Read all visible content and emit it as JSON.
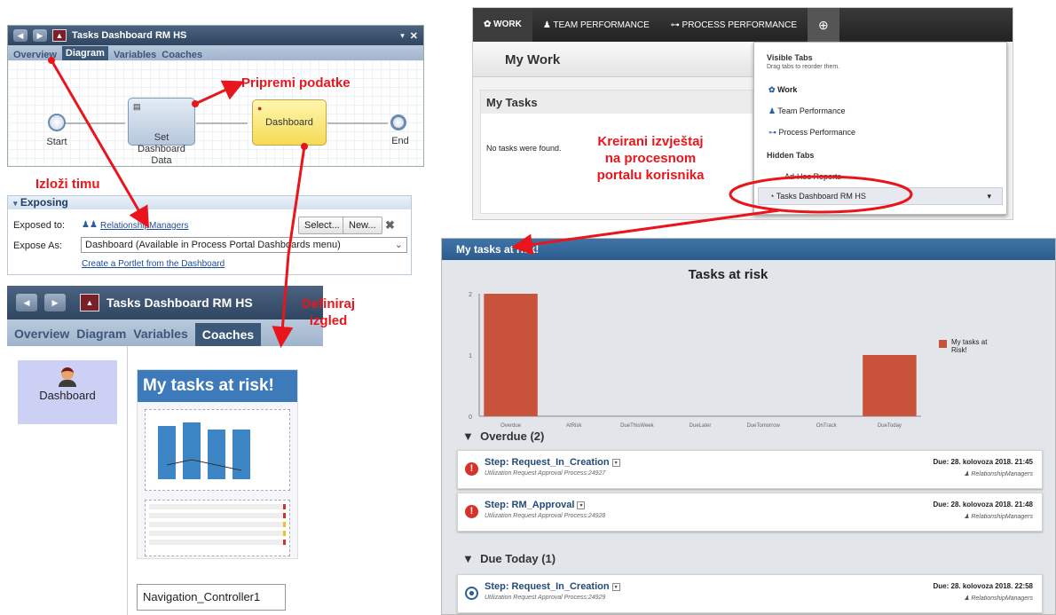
{
  "designer_top": {
    "title": "Tasks Dashboard RM HS",
    "tabs": [
      "Overview",
      "Diagram",
      "Variables",
      "Coaches"
    ],
    "active_tab": "Diagram",
    "nodes": {
      "start": "Start",
      "set_data": "Set\nDashboard\nData",
      "dashboard": "Dashboard",
      "end": "End"
    }
  },
  "exposing": {
    "header": "Exposing",
    "exposed_to_label": "Exposed to:",
    "exposed_to_value": "RelationshipManagers",
    "select_btn": "Select...",
    "new_btn": "New...",
    "expose_as_label": "Expose As:",
    "expose_as_value": "Dashboard (Available in Process Portal Dashboards menu)",
    "portlet_link": "Create a Portlet from the Dashboard"
  },
  "designer_bottom": {
    "title": "Tasks Dashboard RM HS",
    "tabs": [
      "Overview",
      "Diagram",
      "Variables",
      "Coaches"
    ],
    "active_tab": "Coaches",
    "coach_item": "Dashboard",
    "preview_title": "My tasks at risk!",
    "controller": "Navigation_Controller1"
  },
  "annotations": {
    "pripremi": "Pripremi podatke",
    "izlozi": "Izloži timu",
    "definiraj": "Definiraj\nizgled",
    "kreirani": "Kreirani izvještaj\nna procesnom\nportalu korisnika"
  },
  "portal": {
    "nav": [
      "WORK",
      "TEAM PERFORMANCE",
      "PROCESS PERFORMANCE"
    ],
    "my_work": "My Work",
    "my_tasks": "My Tasks",
    "no_tasks": "No tasks were found.",
    "menu": {
      "visible_header": "Visible Tabs",
      "visible_hint": "Drag tabs to reorder them.",
      "items": [
        "Work",
        "Team Performance",
        "Process Performance"
      ],
      "hidden_header": "Hidden Tabs",
      "hidden_items": [
        "Ad-Hoc Reports",
        "Tasks Dashboard RM HS"
      ]
    }
  },
  "report": {
    "header": "My tasks at risk!",
    "chart_title": "Tasks at risk",
    "legend": "My tasks at\nRisk!",
    "overdue_header": "Overdue (2)",
    "duetoday_header": "Due Today (1)",
    "tasks": [
      {
        "name": "Step: Request_In_Creation",
        "sub": "Utilization Request Approval Process:24927",
        "due": "Due: 28. kolovoza 2018. 21:45",
        "group": "RelationshipManagers"
      },
      {
        "name": "Step: RM_Approval",
        "sub": "Utilization Request Approval Process:24928",
        "due": "Due: 28. kolovoza 2018. 21:48",
        "group": "RelationshipManagers"
      },
      {
        "name": "Step: Request_In_Creation",
        "sub": "Utilization Request Approval Process:24929",
        "due": "Due: 28. kolovoza 2018. 22:58",
        "group": "RelationshipManagers"
      }
    ]
  },
  "chart_data": {
    "type": "bar",
    "title": "Tasks at risk",
    "categories": [
      "Overdue",
      "AtRisk",
      "DueThisWeek",
      "DueLater",
      "DueTomorrow",
      "OnTrack",
      "DueToday"
    ],
    "series": [
      {
        "name": "My tasks at Risk!",
        "values": [
          2,
          0,
          0,
          0,
          0,
          0,
          1
        ]
      }
    ],
    "ylim": [
      0,
      2
    ],
    "yticks": [
      0,
      1,
      2
    ],
    "color": "#c8523a",
    "grid": false,
    "legend": "right"
  }
}
